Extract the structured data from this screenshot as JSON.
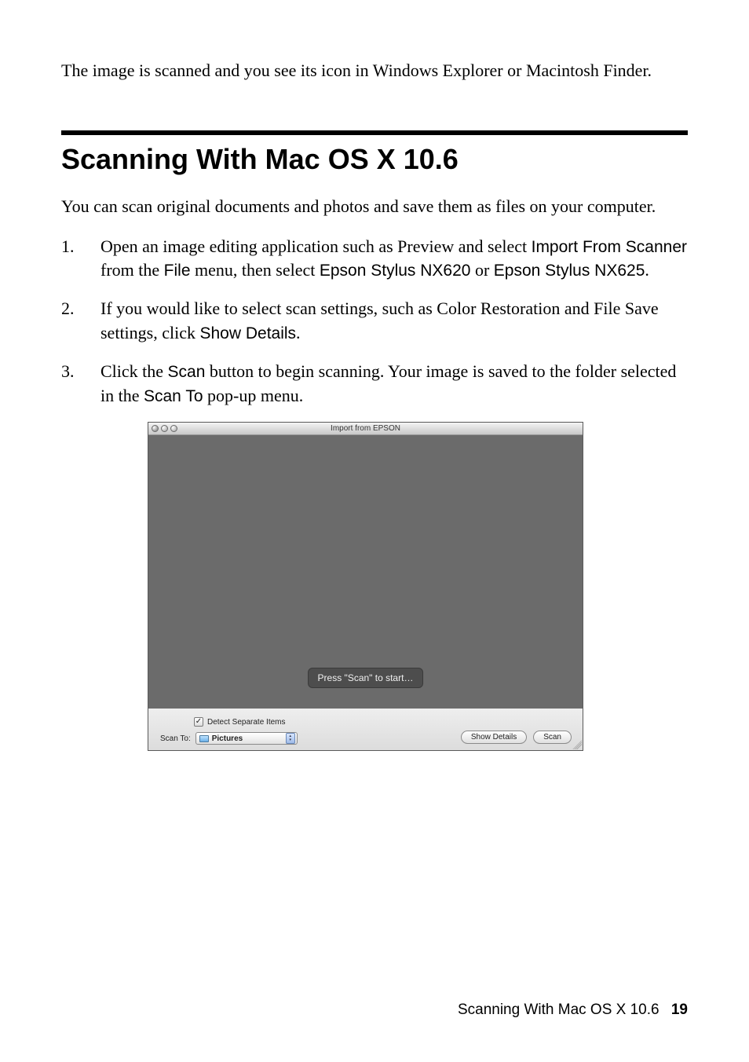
{
  "intro": "The image is scanned and you see its icon in Windows Explorer or Macintosh Finder.",
  "heading": "Scanning With Mac OS X 10.6",
  "section_intro": "You can scan original documents and photos and save them as files on your computer.",
  "steps": {
    "s1": {
      "t1": "Open an image editing application such as Preview and select ",
      "u1": "Import From Scanner",
      "t2": " from the ",
      "u2": "File",
      "t3": " menu, then select ",
      "u3": "Epson Stylus NX620",
      "t4": " or ",
      "u4": "Epson Stylus NX625",
      "t5": "."
    },
    "s2": {
      "t1": "If you would like to select scan settings, such as Color Restoration and File Save settings, click ",
      "u1": "Show Details",
      "t2": "."
    },
    "s3": {
      "t1": "Click the ",
      "u1": "Scan",
      "t2": " button to begin scanning. Your image is saved to the folder selected in the ",
      "u2": "Scan To",
      "t3": " pop-up menu."
    }
  },
  "window": {
    "title": "Import from EPSON",
    "hint": "Press \"Scan\" to start…",
    "detect_label": "Detect Separate Items",
    "detect_checked": "✓",
    "scan_to_label": "Scan To:",
    "scan_to_value": "Pictures",
    "show_details_btn": "Show Details",
    "scan_btn": "Scan"
  },
  "footer": {
    "text": "Scanning With Mac OS X 10.6",
    "page": "19"
  }
}
